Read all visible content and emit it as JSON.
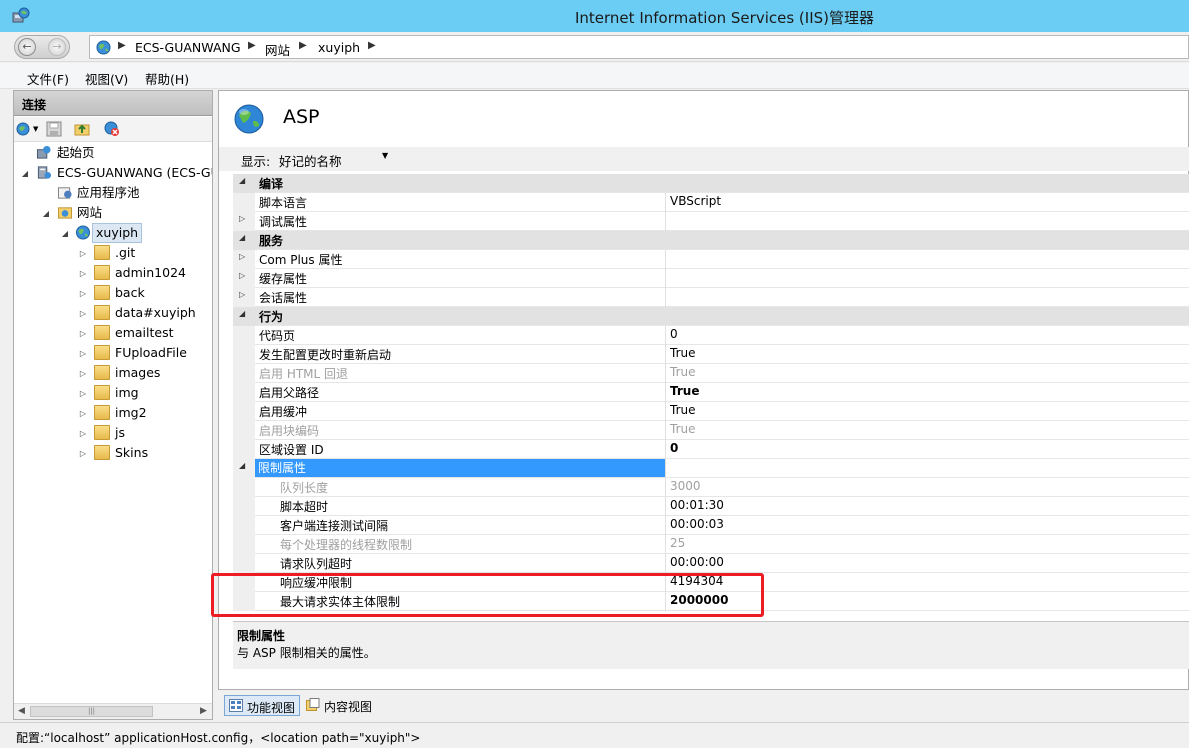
{
  "window": {
    "title": "Internet Information Services (IIS)管理器"
  },
  "address": {
    "crumbs": [
      "ECS-GUANWANG",
      "网站",
      "xuyiph"
    ]
  },
  "menu": {
    "file": "文件(F)",
    "view": "视图(V)",
    "help": "帮助(H)"
  },
  "connections": {
    "title": "连接",
    "tree": {
      "start_page": "起始页",
      "server": "ECS-GUANWANG (ECS-GU",
      "app_pools": "应用程序池",
      "sites": "网站",
      "site": "xuyiph",
      "folders": [
        ".git",
        "admin1024",
        "back",
        "data#xuyiph",
        "emailtest",
        "FUploadFile",
        "images",
        "img",
        "img2",
        "js",
        "Skins"
      ]
    }
  },
  "feature": {
    "title": "ASP",
    "display_label": "显示:",
    "display_value": "好记的名称"
  },
  "grid": {
    "rows": [
      {
        "name": "编译",
        "value": ""
      },
      {
        "name": "脚本语言",
        "value": "VBScript"
      },
      {
        "name": "调试属性",
        "value": ""
      },
      {
        "name": "服务",
        "value": ""
      },
      {
        "name": "Com Plus 属性",
        "value": ""
      },
      {
        "name": "缓存属性",
        "value": ""
      },
      {
        "name": "会话属性",
        "value": ""
      },
      {
        "name": "行为",
        "value": ""
      },
      {
        "name": "代码页",
        "value": "0"
      },
      {
        "name": "发生配置更改时重新启动",
        "value": "True"
      },
      {
        "name": "启用 HTML 回退",
        "value": "True"
      },
      {
        "name": "启用父路径",
        "value": "True"
      },
      {
        "name": "启用缓冲",
        "value": "True"
      },
      {
        "name": "启用块编码",
        "value": "True"
      },
      {
        "name": "区域设置 ID",
        "value": "0"
      },
      {
        "name": "限制属性",
        "value": ""
      },
      {
        "name": "队列长度",
        "value": "3000"
      },
      {
        "name": "脚本超时",
        "value": "00:01:30"
      },
      {
        "name": "客户端连接测试间隔",
        "value": "00:00:03"
      },
      {
        "name": "每个处理器的线程数限制",
        "value": "25"
      },
      {
        "name": "请求队列超时",
        "value": "00:00:00"
      },
      {
        "name": "响应缓冲限制",
        "value": "4194304"
      },
      {
        "name": "最大请求实体主体限制",
        "value": "2000000"
      }
    ]
  },
  "description": {
    "title": "限制属性",
    "text": "与 ASP 限制相关的属性。"
  },
  "view_tabs": {
    "features": "功能视图",
    "content": "内容视图"
  },
  "status": {
    "text": "配置:“localhost” applicationHost.config，<location path=\"xuyiph\">"
  },
  "colors": {
    "titlebar": "#6ccdf4",
    "selection": "#3399ff",
    "highlight_box": "#ec1b24"
  }
}
